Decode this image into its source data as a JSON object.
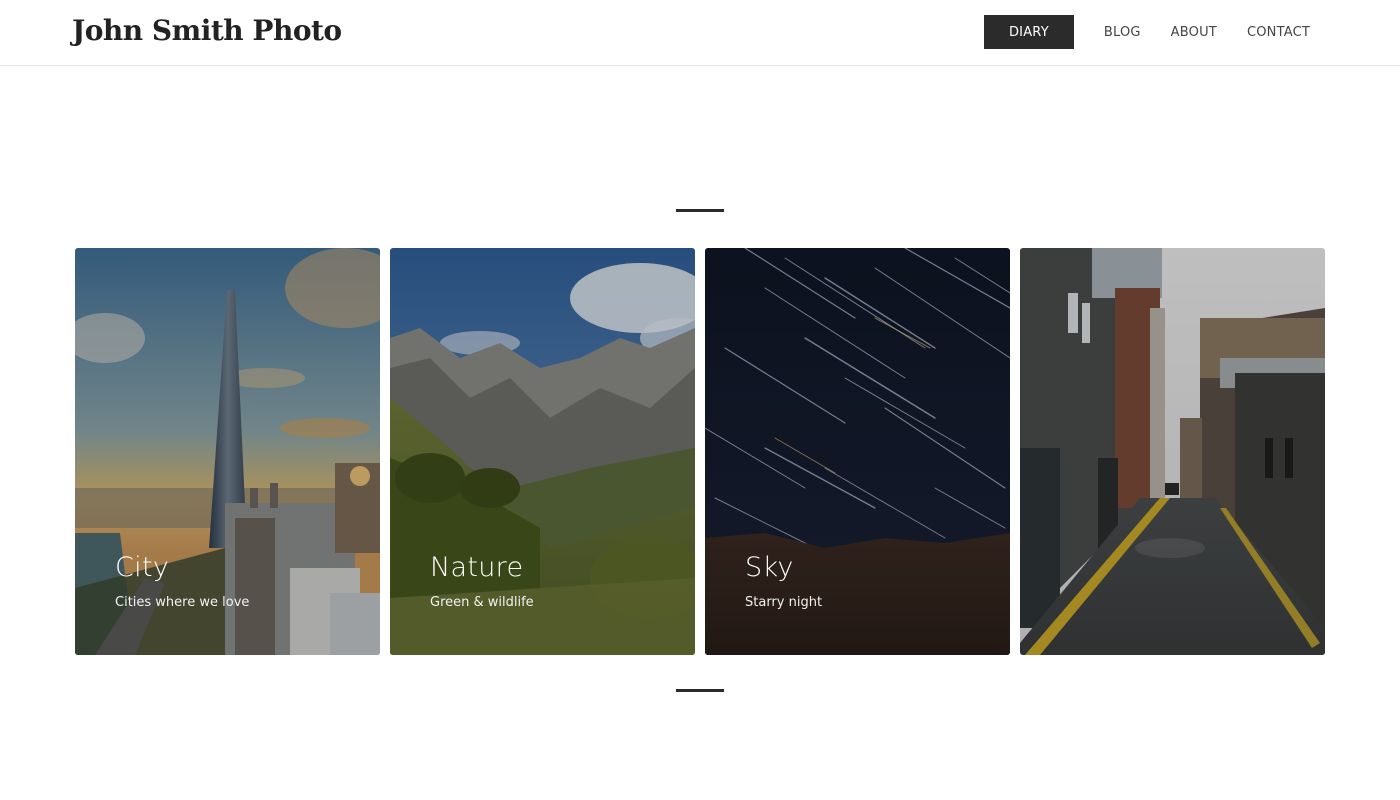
{
  "header": {
    "logo": "John Smith Photo",
    "nav": [
      {
        "label": "DIARY",
        "active": true
      },
      {
        "label": "BLOG",
        "active": false
      },
      {
        "label": "ABOUT",
        "active": false
      },
      {
        "label": "CONTACT",
        "active": false
      }
    ]
  },
  "cards": [
    {
      "title": "City",
      "subtitle": "Cities where we love"
    },
    {
      "title": "Nature",
      "subtitle": "Green & wildlife"
    },
    {
      "title": "Sky",
      "subtitle": "Starry night"
    },
    {
      "title": "",
      "subtitle": ""
    }
  ],
  "colors": {
    "nav_active_bg": "#2b2b2b",
    "divider": "#2b2b2b",
    "text": "#222222"
  }
}
